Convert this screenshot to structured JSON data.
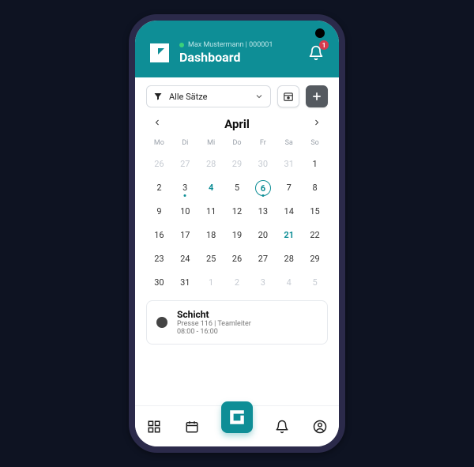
{
  "header": {
    "user": "Max Mustermann | 000001",
    "title": "Dashboard",
    "notification_count": "1"
  },
  "toolbar": {
    "filter_label": "Alle Sätze"
  },
  "calendar": {
    "month": "April",
    "dow": [
      "Mo",
      "Di",
      "Mi",
      "Do",
      "Fr",
      "Sa",
      "So"
    ],
    "weeks": [
      [
        {
          "n": "26",
          "t": "prev"
        },
        {
          "n": "27",
          "t": "prev"
        },
        {
          "n": "28",
          "t": "prev"
        },
        {
          "n": "29",
          "t": "prev"
        },
        {
          "n": "30",
          "t": "prev"
        },
        {
          "n": "31",
          "t": "prev"
        },
        {
          "n": "1",
          "t": "cur"
        }
      ],
      [
        {
          "n": "2",
          "t": "cur"
        },
        {
          "n": "3",
          "t": "cur",
          "dot": true
        },
        {
          "n": "4",
          "t": "hl"
        },
        {
          "n": "5",
          "t": "cur"
        },
        {
          "n": "6",
          "t": "sel",
          "dot": true
        },
        {
          "n": "7",
          "t": "cur"
        },
        {
          "n": "8",
          "t": "cur"
        }
      ],
      [
        {
          "n": "9",
          "t": "cur"
        },
        {
          "n": "10",
          "t": "cur"
        },
        {
          "n": "11",
          "t": "cur"
        },
        {
          "n": "12",
          "t": "cur"
        },
        {
          "n": "13",
          "t": "cur"
        },
        {
          "n": "14",
          "t": "cur"
        },
        {
          "n": "15",
          "t": "cur"
        }
      ],
      [
        {
          "n": "16",
          "t": "cur"
        },
        {
          "n": "17",
          "t": "cur"
        },
        {
          "n": "18",
          "t": "cur"
        },
        {
          "n": "19",
          "t": "cur"
        },
        {
          "n": "20",
          "t": "cur"
        },
        {
          "n": "21",
          "t": "hl"
        },
        {
          "n": "22",
          "t": "cur"
        }
      ],
      [
        {
          "n": "23",
          "t": "cur"
        },
        {
          "n": "24",
          "t": "cur"
        },
        {
          "n": "25",
          "t": "cur"
        },
        {
          "n": "26",
          "t": "cur"
        },
        {
          "n": "27",
          "t": "cur"
        },
        {
          "n": "28",
          "t": "cur"
        },
        {
          "n": "29",
          "t": "cur"
        }
      ],
      [
        {
          "n": "30",
          "t": "cur"
        },
        {
          "n": "31",
          "t": "cur"
        },
        {
          "n": "1",
          "t": "next"
        },
        {
          "n": "2",
          "t": "next"
        },
        {
          "n": "3",
          "t": "next"
        },
        {
          "n": "4",
          "t": "next"
        },
        {
          "n": "5",
          "t": "next"
        }
      ]
    ]
  },
  "event": {
    "title": "Schicht",
    "subtitle": "Presse 116 | Teamleiter",
    "time": "08:00 - 16:00"
  },
  "colors": {
    "accent": "#0e8e96"
  }
}
